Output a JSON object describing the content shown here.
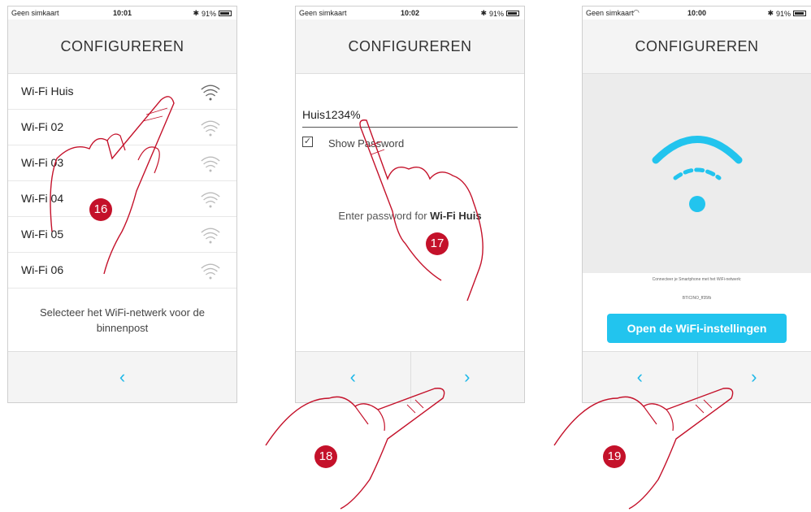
{
  "colors": {
    "accent": "#22c4ee",
    "badge": "#c4112a",
    "hand": "#c4112a"
  },
  "screen1": {
    "status": {
      "carrier": "Geen simkaart",
      "time": "10:01",
      "battery": "91%"
    },
    "title": "CONFIGUREREN",
    "networks": [
      {
        "label": "Wi-Fi Huis",
        "icon": "wifi-signal-icon"
      },
      {
        "label": "Wi-Fi 02",
        "icon": "wifi-signal-icon"
      },
      {
        "label": "Wi-Fi 03",
        "icon": "wifi-signal-icon"
      },
      {
        "label": "Wi-Fi 04",
        "icon": "wifi-signal-icon"
      },
      {
        "label": "Wi-Fi 05",
        "icon": "wifi-signal-icon"
      },
      {
        "label": "Wi-Fi 06",
        "icon": "wifi-signal-icon"
      }
    ],
    "message": "Selecteer het WiFi-netwerk voor de binnenpost",
    "back_icon": "‹",
    "step_badge": "16"
  },
  "screen2": {
    "status": {
      "carrier": "Geen simkaart",
      "time": "10:02",
      "battery": "91%"
    },
    "title": "CONFIGUREREN",
    "password_value": "Huis1234%",
    "show_password_label": "Show Password",
    "enter_password_prefix": "Enter password for ",
    "enter_password_network": "Wi-Fi Huis",
    "back_icon": "‹",
    "next_icon": "›",
    "step_badge": "17",
    "step_badge_nav": "18"
  },
  "screen3": {
    "status": {
      "carrier": "Geen simkaart",
      "time": "10:00",
      "battery": "91%"
    },
    "title": "CONFIGUREREN",
    "connect_text": "Connecteer je Smartphone met het WiFi-netwerk:",
    "network_name": "BTICINO_ff35fb",
    "open_button": "Open de WiFi-instellingen",
    "back_icon": "‹",
    "next_icon": "›",
    "step_badge": "19"
  }
}
